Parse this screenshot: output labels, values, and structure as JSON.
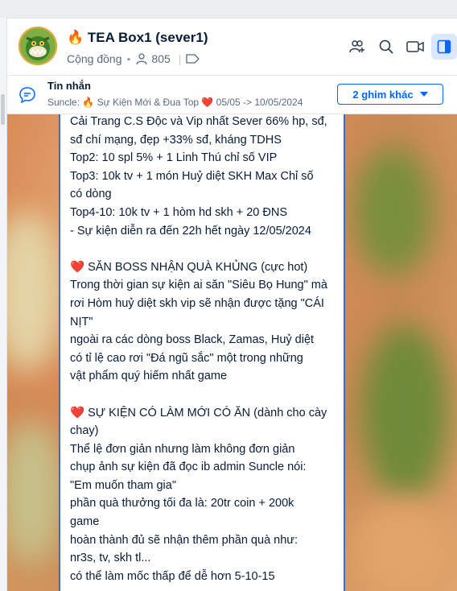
{
  "header": {
    "title": "🔥 TEA Box1 (sever1)",
    "community_label": "Cộng đồng",
    "member_count": "805"
  },
  "pinned": {
    "label": "Tin nhắn",
    "summary": "Suncle: 🔥 Sự Kiện Mới & Đua Top ❤️ 05/05 -> 10/05/2024",
    "more_button": "2 ghim khác"
  },
  "message": {
    "lines": [
      "Cải Trang C.S Độc và Vip nhất Sever 66% hp, sđ,",
      "sđ chí mạng, đẹp +33% sđ, kháng TDHS",
      "Top2: 10 spl 5% + 1 Linh Thú chỉ số VIP",
      "Top3: 10k tv + 1 món Huỷ diệt SKH Max Chỉ số",
      "có dòng",
      "Top4-10: 10k tv + 1 hòm hd skh + 20 ĐNS",
      "- Sự kiện diễn ra đến 22h hết ngày 12/05/2024",
      "",
      "❤️ SĂN BOSS NHẬN QUÀ KHỦNG (cực hot)",
      "Trong thời gian sự kiện ai săn \"Siêu Bọ Hung\" mà",
      "rơi Hòm huỷ diệt skh vip sẽ nhận được tặng \"CÁI",
      "NỊT\"",
      "ngoài ra các dòng boss Black, Zamas, Huỷ diệt",
      "có tỉ lệ cao rơi \"Đá ngũ sắc\" một trong những",
      "vật phẩm quý hiếm nhất game",
      "",
      "❤️ SỰ KIỆN CÓ LÀM MỚI CÓ ĂN (dành cho cày",
      "chay)",
      "Thể lệ đơn giản nhưng làm không đơn giản",
      "chụp ảnh sự kiện đã đọc ib admin Suncle nói:",
      "\"Em muốn tham gia\"",
      "phần quà thưởng tối đa là: 20tr coin + 200k",
      "game",
      "hoàn thành đủ sẽ nhận thêm phần quà như:",
      "nr3s, tv, skh tl...",
      "có thể làm mốc thấp để dễ hơn 5-10-15"
    ]
  },
  "colors": {
    "accent": "#0068ff",
    "active_bg": "#dbe7ff",
    "bubble_border": "#3a6bd6"
  },
  "icons": [
    "avatar",
    "members-icon",
    "tag-icon",
    "add-group-icon",
    "search-icon",
    "video-icon",
    "sidebar-toggle-icon",
    "chat-bubble-icon",
    "caret-down-icon"
  ]
}
